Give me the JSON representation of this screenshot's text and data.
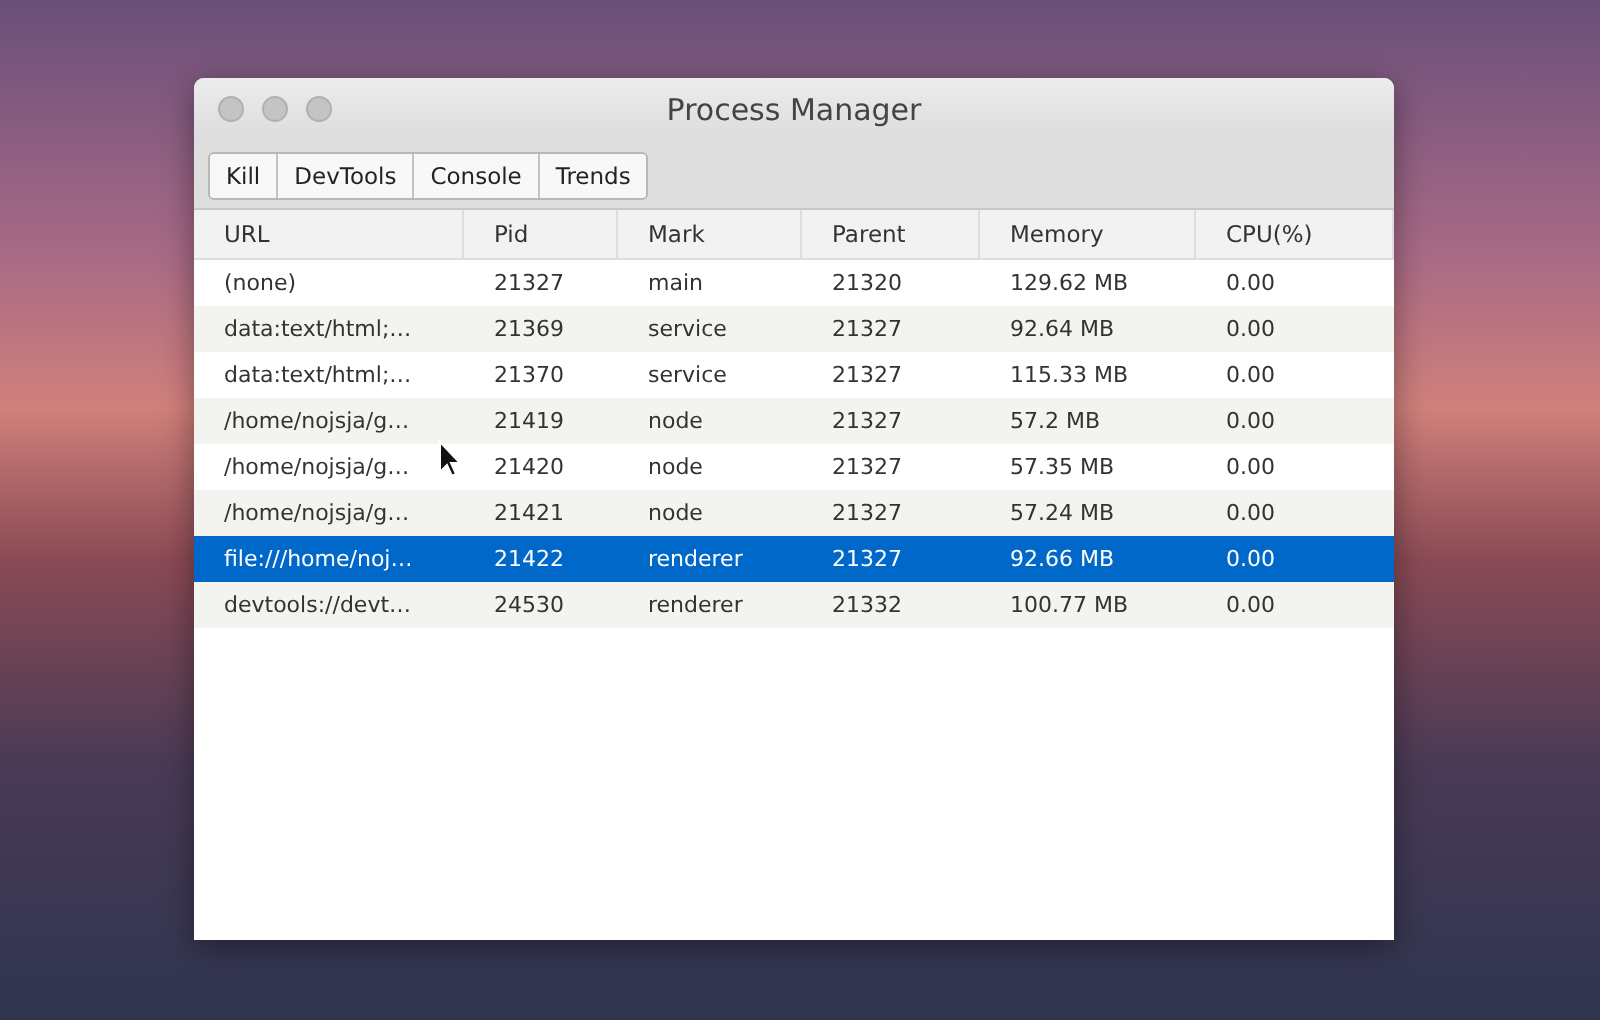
{
  "window": {
    "title": "Process Manager"
  },
  "toolbar": {
    "buttons": [
      "Kill",
      "DevTools",
      "Console",
      "Trends"
    ]
  },
  "table": {
    "columns": [
      "URL",
      "Pid",
      "Mark",
      "Parent",
      "Memory",
      "CPU(%)"
    ],
    "rows": [
      {
        "cells": [
          "(none)",
          "21327",
          "main",
          "21320",
          "129.62 MB",
          "0.00"
        ],
        "selected": false
      },
      {
        "cells": [
          "data:text/html;…",
          "21369",
          "service",
          "21327",
          "92.64 MB",
          "0.00"
        ],
        "selected": false
      },
      {
        "cells": [
          "data:text/html;…",
          "21370",
          "service",
          "21327",
          "115.33 MB",
          "0.00"
        ],
        "selected": false
      },
      {
        "cells": [
          "/home/nojsja/g…",
          "21419",
          "node",
          "21327",
          "57.2 MB",
          "0.00"
        ],
        "selected": false
      },
      {
        "cells": [
          "/home/nojsja/g…",
          "21420",
          "node",
          "21327",
          "57.35 MB",
          "0.00"
        ],
        "selected": false
      },
      {
        "cells": [
          "/home/nojsja/g…",
          "21421",
          "node",
          "21327",
          "57.24 MB",
          "0.00"
        ],
        "selected": false
      },
      {
        "cells": [
          "file:///home/noj…",
          "21422",
          "renderer",
          "21327",
          "92.66 MB",
          "0.00"
        ],
        "selected": true
      },
      {
        "cells": [
          "devtools://devt…",
          "24530",
          "renderer",
          "21332",
          "100.77 MB",
          "0.00"
        ],
        "selected": false
      }
    ]
  }
}
